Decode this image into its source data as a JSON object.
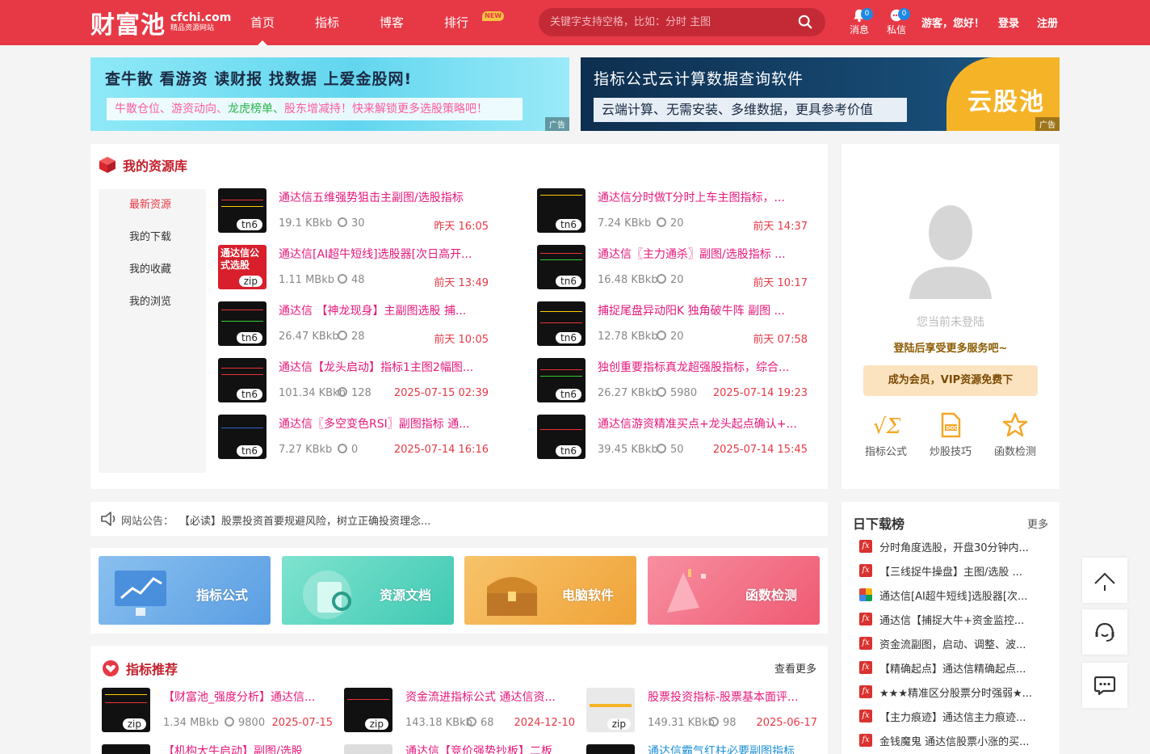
{
  "header": {
    "logo_cn": "财富池",
    "logo_domain": "cfchi.com",
    "logo_tag": "精品资源网站",
    "nav": [
      {
        "label": "首页",
        "active": true
      },
      {
        "label": "指标"
      },
      {
        "label": "博客"
      },
      {
        "label": "排行",
        "badge": "NEW"
      }
    ],
    "search_placeholder": "关键字支持空格，比如：分时 主图",
    "messages_label": "消息",
    "messages_count": "0",
    "private_label": "私信",
    "private_count": "0",
    "guest_text": "游客，您好！",
    "login": "登录",
    "register": "注册"
  },
  "banners": {
    "left_title": "查牛散 看游资 读财报 找数据 上爱金股网!",
    "left_sub_parts": [
      "牛散仓位、",
      "游资动向、",
      "龙虎榜单、",
      "股东增减持！",
      "快来解锁更多选股策略吧！"
    ],
    "right_title": "指标公式云计算数据查询软件",
    "right_sub": "云端计算、无需安装、多维数据，更具参考价值",
    "right_brand": "云股池",
    "ad_tag": "广告"
  },
  "resources": {
    "title": "我的资源库",
    "side": [
      "最新资源",
      "我的下载",
      "我的收藏",
      "我的浏览"
    ],
    "items": [
      {
        "title": "通达信五维强势狙击主副图/选股指标",
        "size": "19.1 KBkb",
        "downloads": "30",
        "time": "昨天 16:05",
        "tag": "tn6"
      },
      {
        "title": "通达信分时做T分时上车主图指标，...",
        "size": "7.24 KBkb",
        "downloads": "20",
        "time": "前天 14:37",
        "tag": "tn6"
      },
      {
        "title": "通达信[AI超牛短线]选股器[次日高开...",
        "size": "1.11 MBkb",
        "downloads": "48",
        "time": "前天 13:49",
        "tag": "zip",
        "thumb_text": "通达信公式选股"
      },
      {
        "title": "通达信〖主力通杀〗副图/选股指标 ...",
        "size": "16.48 KBkb",
        "downloads": "20",
        "time": "前天 10:17",
        "tag": "tn6"
      },
      {
        "title": "通达信 【神龙现身】主副图选股 捕...",
        "size": "26.47 KBkb",
        "downloads": "28",
        "time": "前天 10:05",
        "tag": "tn6"
      },
      {
        "title": "捕捉尾盘异动阳K 独角破牛阵 副图 ...",
        "size": "12.78 KBkb",
        "downloads": "20",
        "time": "前天 07:58",
        "tag": "tn6"
      },
      {
        "title": "通达信【龙头启动】指标1主图2幅图...",
        "size": "101.34 KBkb",
        "downloads": "128",
        "time": "2025-07-15 02:39",
        "tag": "tn6"
      },
      {
        "title": "独创重要指标真龙超强股指标，综合...",
        "size": "26.27 KBkb",
        "downloads": "5980",
        "time": "2025-07-14 19:23",
        "tag": "tn6"
      },
      {
        "title": "通达信〖多空变色RSI〗副图指标 通...",
        "size": "7.27 KBkb",
        "downloads": "0",
        "time": "2025-07-14 16:16",
        "tag": "tn6"
      },
      {
        "title": "通达信游资精准买点+龙头起点确认+...",
        "size": "39.45 KBkb",
        "downloads": "50",
        "time": "2025-07-14 15:45",
        "tag": "tn6"
      }
    ]
  },
  "login_panel": {
    "not_login": "您当前未登陆",
    "tip": "登陆后享受更多服务吧~",
    "vip": "成为会员，VIP资源免费下",
    "tools": [
      "指标公式",
      "炒股技巧",
      "函数检测"
    ]
  },
  "notice": {
    "label": "网站公告：",
    "text": "【必读】股票投资首要规避风险，树立正确投资理念..."
  },
  "categories": [
    "指标公式",
    "资源文档",
    "电脑软件",
    "函数检测"
  ],
  "recommend": {
    "title": "指标推荐",
    "more": "查看更多",
    "items": [
      {
        "title": "【财富池_强度分析】通达信...",
        "size": "1.34 MBkb",
        "downloads": "9800",
        "time": "2025-07-15",
        "tag": "zip"
      },
      {
        "title": "资金流进指标公式 通达信资...",
        "size": "143.18 KBkb",
        "downloads": "68",
        "time": "2024-12-10",
        "tag": "zip"
      },
      {
        "title": "股票投资指标-股票基本面评...",
        "size": "149.31 KBkb",
        "downloads": "98",
        "time": "2025-06-17",
        "tag": "zip"
      }
    ],
    "row2": [
      "【机构大牛启动】副图/选股",
      "通达信【竞价强势抄板】二板",
      "通达信霸气红柱必要副图指标"
    ]
  },
  "rank": {
    "title": "日下载榜",
    "more": "更多",
    "items": [
      "分时角度选股，开盘30分钟内...",
      "【三线捉牛操盘】主图/选股 ...",
      "通达信[AI超牛短线]选股器[次...",
      "通达信【捕捉大牛+资金监控...",
      "资金流副图，启动、调整、波...",
      "【精确起点】通达信精确起点...",
      "★★★精准区分股票分时强弱★...",
      "【主力痕迹】通达信主力痕迹...",
      "金钱魔鬼 通达信股票小涨的买..."
    ]
  }
}
